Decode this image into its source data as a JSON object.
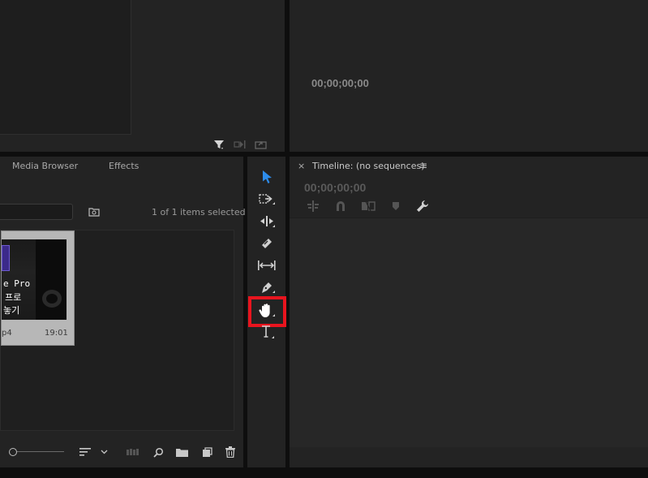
{
  "source_monitor": {
    "icons": [
      "filter-icon",
      "insert-icon",
      "export-frame-icon"
    ]
  },
  "program_monitor": {
    "timecode": "00;00;00;00"
  },
  "project_panel": {
    "tabs": [
      {
        "label": "Media Browser"
      },
      {
        "label": "Effects"
      }
    ],
    "search_placeholder": "",
    "selection_status": "1 of 1 items selected",
    "clip": {
      "overlay_lines": [
        "e Pro",
        "프로",
        "놓기"
      ],
      "filename_fragment": "p4",
      "duration": "19:01"
    },
    "bottom_icons": [
      "zoom-slider",
      "sort-icon",
      "chevron-down-icon",
      "automate-icon",
      "find-icon",
      "new-bin-icon",
      "new-item-icon",
      "trash-icon"
    ]
  },
  "tools": {
    "items": [
      "selection-tool",
      "track-select-tool",
      "ripple-edit-tool",
      "razor-tool",
      "slip-tool",
      "pen-tool",
      "hand-tool",
      "type-tool"
    ],
    "highlighted": "hand-tool",
    "accent_color": "#2d8ceb",
    "highlight_color": "#e8141e"
  },
  "timeline": {
    "close_label": "×",
    "title": "Timeline: (no sequences)",
    "menu_label": "≡",
    "timecode": "00;00;00;00"
  }
}
